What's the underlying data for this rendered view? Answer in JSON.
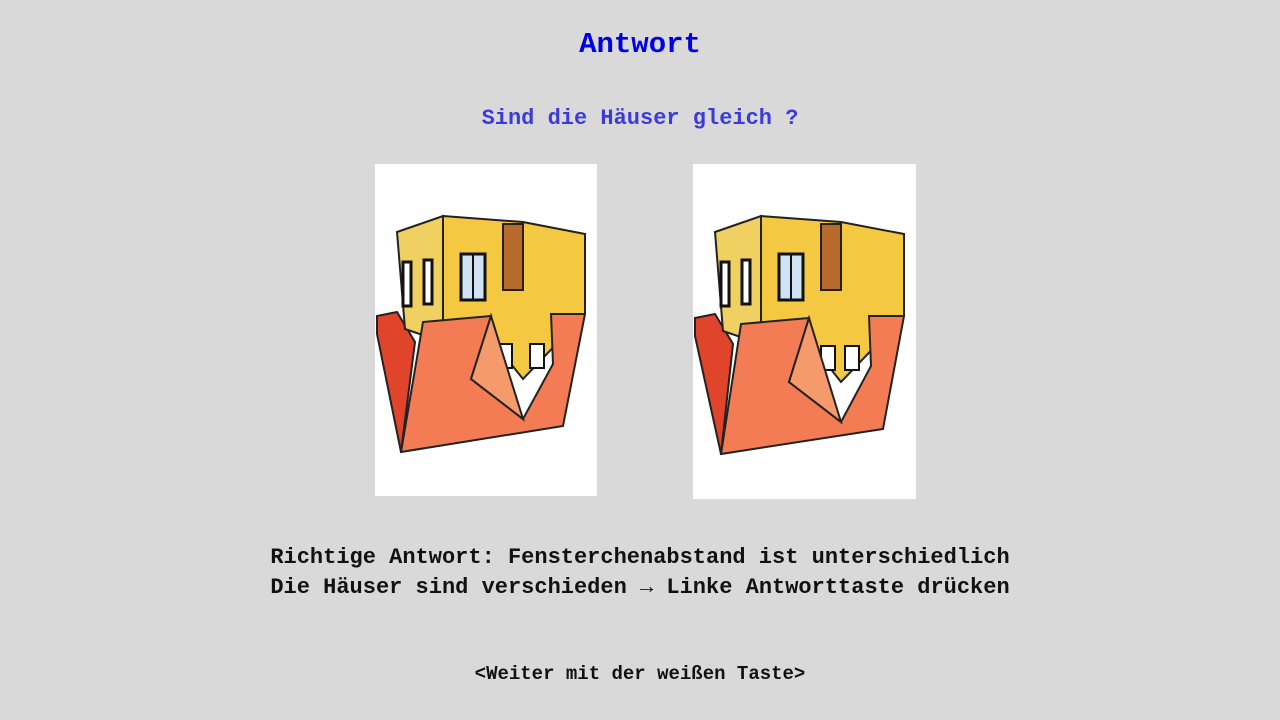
{
  "title": "Antwort",
  "question": "Sind die Häuser gleich ?",
  "answer": {
    "line1": "Richtige Antwort: Fensterchenabstand ist unterschiedlich",
    "line2_before": "Die Häuser sind verschieden ",
    "line2_arrow": "→",
    "line2_after": " Linke Antworttaste drücken"
  },
  "continue_hint": "<Weiter mit der weißen Taste>",
  "colors": {
    "background": "#d9d9d9",
    "title": "#0000e6",
    "question": "#3b3bdc",
    "wall_yellow": "#f5c842",
    "roof_orange": "#f47c54",
    "roof_dark": "#e0442a",
    "door_brown": "#b86a2a"
  },
  "images": [
    {
      "name": "house-left",
      "depiction": "upside-down house"
    },
    {
      "name": "house-right",
      "depiction": "upside-down house"
    }
  ]
}
